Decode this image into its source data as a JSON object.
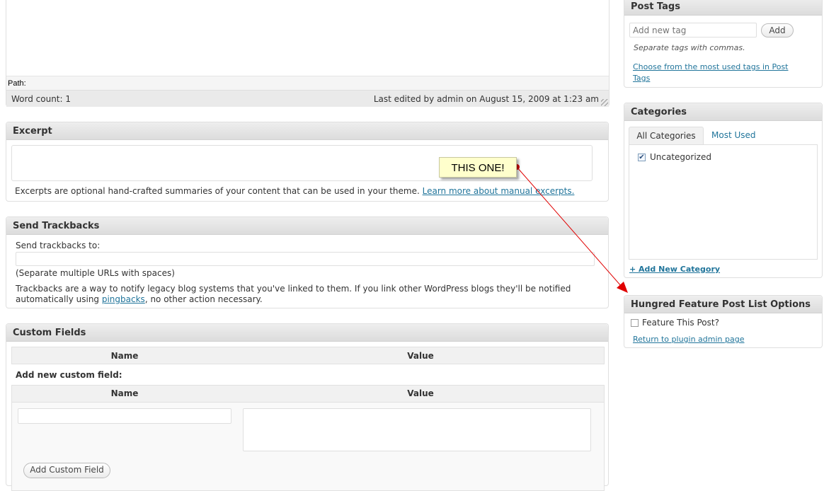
{
  "editor": {
    "path_label": "Path:",
    "word_count": "Word count: 1",
    "last_edited": "Last edited by admin on August 15, 2009 at 1:23 am"
  },
  "excerpt": {
    "title": "Excerpt",
    "help_text": "Excerpts are optional hand-crafted summaries of your content that can be used in your theme.",
    "help_link": "Learn more about manual excerpts."
  },
  "trackbacks": {
    "title": "Send Trackbacks",
    "label": "Send trackbacks to:",
    "hint": "(Separate multiple URLs with spaces)",
    "desc_before_link": "Trackbacks are a way to notify legacy blog systems that you've linked to them. If you link other WordPress blogs they'll be notified automatically using ",
    "desc_link": "pingbacks",
    "desc_after_link": ", no other action necessary."
  },
  "custom_fields": {
    "title": "Custom Fields",
    "col_name": "Name",
    "col_value": "Value",
    "add_new_label": "Add new custom field:",
    "add_button": "Add Custom Field"
  },
  "post_tags": {
    "title": "Post Tags",
    "placeholder": "Add new tag",
    "add_button": "Add",
    "hint": "Separate tags with commas.",
    "choose_link": "Choose from the most used tags in Post Tags"
  },
  "categories": {
    "title": "Categories",
    "tab_all": "All Categories",
    "tab_most_used": "Most Used",
    "items": [
      {
        "label": "Uncategorized",
        "checked": true
      }
    ],
    "add_link": "+ Add New Category"
  },
  "hungred": {
    "title": "Hungred Feature Post List Options",
    "checkbox_label": "Feature This Post?",
    "return_link": "Return to plugin admin page"
  },
  "annotation": {
    "callout_text": "THIS ONE!",
    "arrow_color": "#e00000"
  }
}
